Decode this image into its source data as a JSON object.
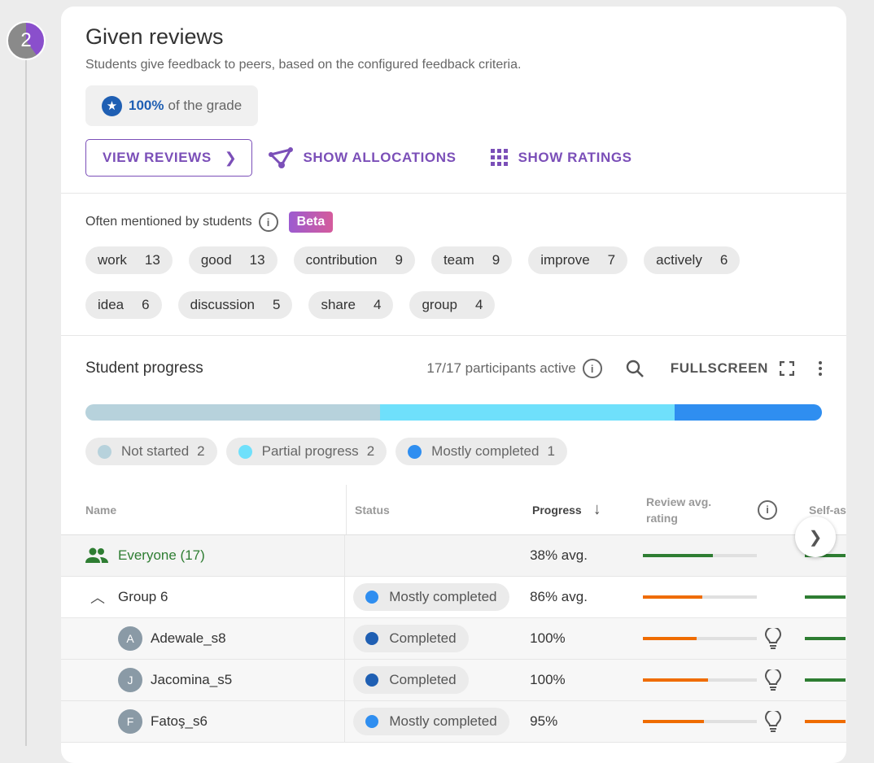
{
  "step": {
    "number": "2"
  },
  "header": {
    "title": "Given reviews",
    "subtitle": "Students give feedback to peers, based on the configured feedback criteria.",
    "grade_pct": "100%",
    "grade_suffix": "of the grade"
  },
  "actions": {
    "view_reviews": "VIEW REVIEWS",
    "show_allocations": "SHOW ALLOCATIONS",
    "show_ratings": "SHOW RATINGS"
  },
  "mentions": {
    "heading": "Often mentioned by students",
    "beta": "Beta",
    "tags": [
      {
        "word": "work",
        "count": "13"
      },
      {
        "word": "good",
        "count": "13"
      },
      {
        "word": "contribution",
        "count": "9"
      },
      {
        "word": "team",
        "count": "9"
      },
      {
        "word": "improve",
        "count": "7"
      },
      {
        "word": "actively",
        "count": "6"
      },
      {
        "word": "idea",
        "count": "6"
      },
      {
        "word": "discussion",
        "count": "5"
      },
      {
        "word": "share",
        "count": "4"
      },
      {
        "word": "group",
        "count": "4"
      }
    ]
  },
  "progress": {
    "title": "Student progress",
    "active": "17/17 participants active",
    "fullscreen": "FULLSCREEN",
    "bar": [
      {
        "fraction": 0.4,
        "color": "#b7d2dc"
      },
      {
        "fraction": 0.4,
        "color": "#6fe0fb"
      },
      {
        "fraction": 0.2,
        "color": "#2f8ef0"
      }
    ],
    "legend": [
      {
        "label": "Not started",
        "count": "2",
        "color": "#b7d2dc"
      },
      {
        "label": "Partial progress",
        "count": "2",
        "color": "#6fe0fb"
      },
      {
        "label": "Mostly completed",
        "count": "1",
        "color": "#2f8ef0"
      }
    ]
  },
  "table": {
    "headers": {
      "name": "Name",
      "status": "Status",
      "progress": "Progress",
      "review": "Review avg. rating",
      "self": "Self-assessment rating"
    },
    "everyone": {
      "label": "Everyone (17)",
      "progress": "38% avg.",
      "review_fill": 0.61,
      "review_color": "#2e7d32"
    },
    "group": {
      "label": "Group 6",
      "status": "Mostly completed",
      "status_color": "#2f8ef0",
      "progress": "86% avg.",
      "review_fill": 0.52,
      "review_color": "#ef6c00"
    },
    "students": [
      {
        "initial": "A",
        "name": "Adewale_s8",
        "status": "Completed",
        "status_color": "#1f5fb3",
        "progress": "100%",
        "review_fill": 0.47,
        "review_color": "#ef6c00",
        "self_color": "#2e7d32"
      },
      {
        "initial": "J",
        "name": "Jacomina_s5",
        "status": "Completed",
        "status_color": "#1f5fb3",
        "progress": "100%",
        "review_fill": 0.57,
        "review_color": "#ef6c00",
        "self_color": "#2e7d32"
      },
      {
        "initial": "F",
        "name": "Fatoş_s6",
        "status": "Mostly completed",
        "status_color": "#2f8ef0",
        "progress": "95%",
        "review_fill": 0.53,
        "review_color": "#ef6c00",
        "self_color": "#ef6c00"
      }
    ]
  }
}
